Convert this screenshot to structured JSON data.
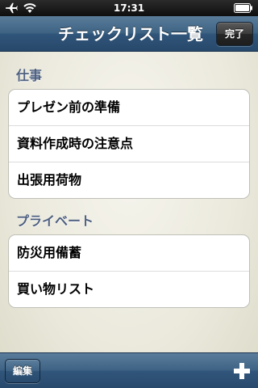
{
  "status_bar": {
    "time": "17:31",
    "icons": [
      "airplane-icon",
      "wifi-icon",
      "battery-icon"
    ]
  },
  "nav": {
    "title": "チェックリスト一覧",
    "done_label": "完了"
  },
  "sections": [
    {
      "header": "仕事",
      "items": [
        "プレゼン前の準備",
        "資料作成時の注意点",
        "出張用荷物"
      ]
    },
    {
      "header": "プライベート",
      "items": [
        "防災用備蓄",
        "買い物リスト"
      ]
    }
  ],
  "toolbar": {
    "edit_label": "編集",
    "add_icon": "plus-icon"
  },
  "colors": {
    "bar_blue": "#3e6383",
    "section_header": "#4d5f80",
    "background": "#ebe9dc"
  }
}
